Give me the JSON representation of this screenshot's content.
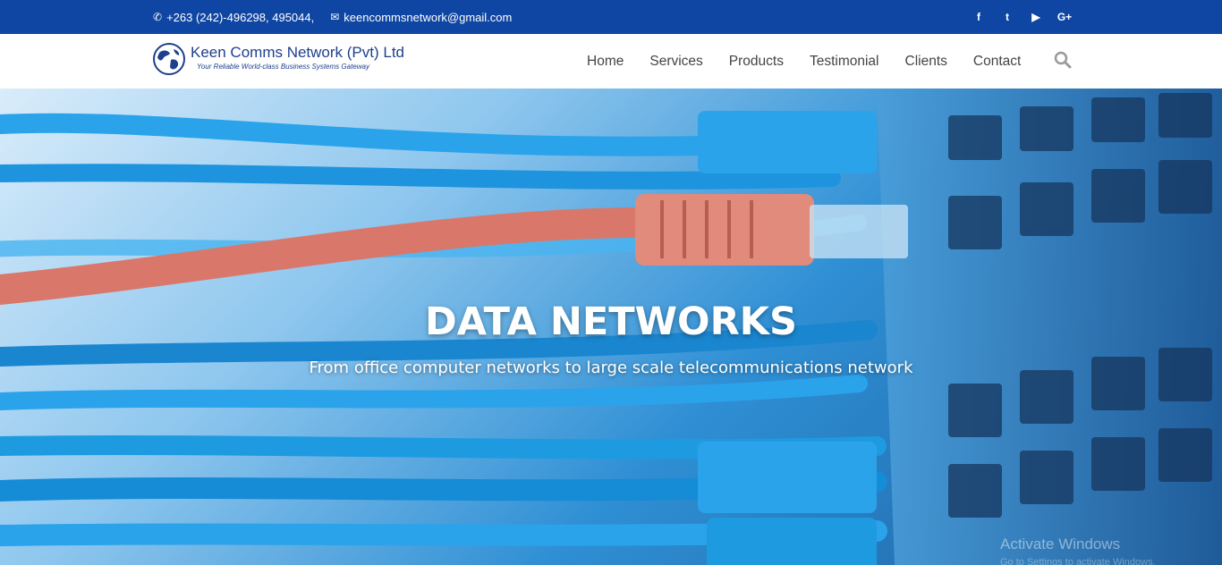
{
  "topbar": {
    "phone_icon": "phone-icon",
    "phone": "+263 (242)-496298, 495044,",
    "email_icon": "envelope-icon",
    "email": "keencommsnetwork@gmail.com",
    "social": [
      {
        "icon": "facebook-icon",
        "glyph": "f"
      },
      {
        "icon": "twitter-icon",
        "glyph": "t"
      },
      {
        "icon": "youtube-icon",
        "glyph": "▶"
      },
      {
        "icon": "google-plus-icon",
        "glyph": "G+"
      }
    ],
    "background": "#0f46a3"
  },
  "navbar": {
    "brand": "Keen Comms Network (Pvt) Ltd",
    "tagline": "Your Reliable World-class Business Systems Gateway",
    "menu": [
      "Home",
      "Services",
      "Products",
      "Testimonial",
      "Clients",
      "Contact"
    ],
    "search_icon": "search-icon"
  },
  "hero": {
    "title": "DATA NETWORKS",
    "subtitle": "From office computer networks to large scale telecommunications network",
    "accent_cable": "#d9786a",
    "cable_blue": "#1e9be0"
  },
  "watermark": {
    "line1": "Activate Windows",
    "line2": "Go to Settings to activate Windows."
  }
}
